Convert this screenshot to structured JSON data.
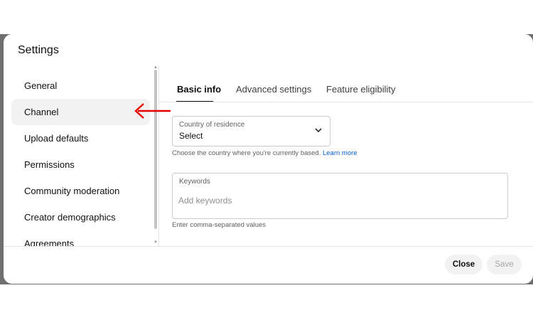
{
  "dialog": {
    "title": "Settings"
  },
  "sidebar": {
    "items": [
      {
        "label": "General",
        "active": false
      },
      {
        "label": "Channel",
        "active": true
      },
      {
        "label": "Upload defaults",
        "active": false
      },
      {
        "label": "Permissions",
        "active": false
      },
      {
        "label": "Community moderation",
        "active": false
      },
      {
        "label": "Creator demographics",
        "active": false
      },
      {
        "label": "Agreements",
        "active": false
      }
    ]
  },
  "tabs": [
    {
      "label": "Basic info",
      "active": true
    },
    {
      "label": "Advanced settings",
      "active": false
    },
    {
      "label": "Feature eligibility",
      "active": false
    }
  ],
  "country": {
    "label": "Country of residence",
    "value": "Select",
    "helper": "Choose the country where you're currently based.",
    "link": "Learn more"
  },
  "keywords": {
    "label": "Keywords",
    "placeholder": "Add keywords",
    "helper": "Enter comma-separated values"
  },
  "footer": {
    "close_label": "Close",
    "save_label": "Save"
  },
  "colors": {
    "annotation_arrow": "#e60000",
    "link": "#065fd4",
    "backdrop": "#6f6f6f"
  }
}
